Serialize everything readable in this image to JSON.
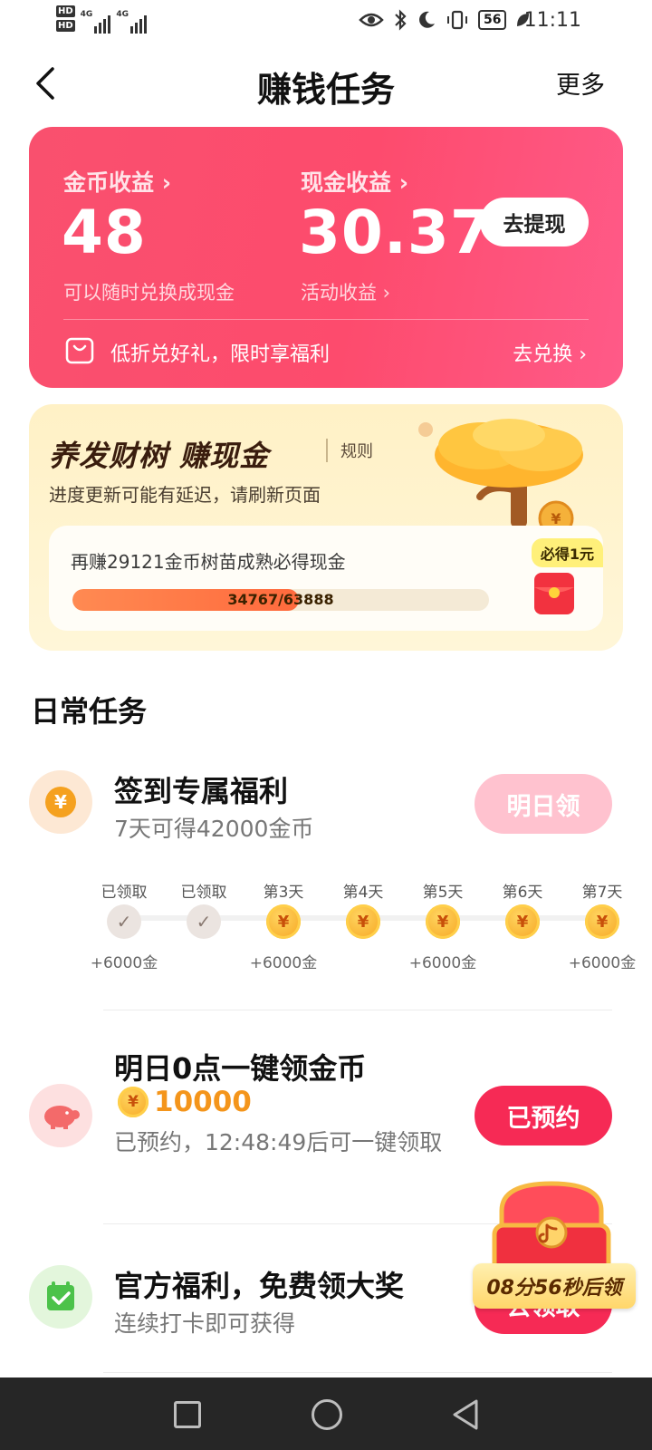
{
  "status_bar": {
    "hd1": "HD",
    "hd2": "HD",
    "signal1": "4G",
    "signal2": "4G",
    "battery": "56",
    "time": "11:11"
  },
  "header": {
    "title": "赚钱任务",
    "more": "更多"
  },
  "earnings": {
    "coin_label": "金币收益 ›",
    "coin_value": "48",
    "coin_sub": "可以随时兑换成现金",
    "cash_label": "现金收益 ›",
    "cash_value": "30.37",
    "cash_sub": "活动收益 ›",
    "withdraw": "去提现",
    "promo": "低折兑好礼，限时享福利",
    "exchange": "去兑换 ›"
  },
  "tree": {
    "title_part1": "养发财树",
    "title_part2": "赚现金",
    "rules": "规则",
    "subtitle": "进度更新可能有延迟，请刷新页面",
    "progress_text": "再赚29121金币树苗成熟必得现金",
    "progress_label": "34767/63888",
    "progress_fraction": 0.544,
    "badge": "必得1元"
  },
  "daily": {
    "section_title": "日常任务",
    "checkin": {
      "title": "签到专属福利",
      "desc": "7天可得42000金币",
      "button": "明日领",
      "days": [
        {
          "label": "已领取",
          "state": "done",
          "reward": "+6000金"
        },
        {
          "label": "已领取",
          "state": "done",
          "reward": ""
        },
        {
          "label": "第3天",
          "state": "coin",
          "reward": "+6000金"
        },
        {
          "label": "第4天",
          "state": "coin",
          "reward": ""
        },
        {
          "label": "第5天",
          "state": "coin",
          "reward": "+6000金"
        },
        {
          "label": "第6天",
          "state": "coin",
          "reward": ""
        },
        {
          "label": "第7天",
          "state": "coin",
          "reward": "+6000金"
        }
      ]
    },
    "gold": {
      "title": "明日0点一键领金币",
      "amount": "10000",
      "desc": "已预约，12:48:49后可一键领取",
      "button": "已预约"
    },
    "official": {
      "title": "官方福利，免费领大奖",
      "desc": "连续打卡即可获得",
      "button": "去领取"
    }
  },
  "chest": {
    "countdown": "08分56秒后领"
  },
  "colors": {
    "card_red": "#fd4b6d",
    "button_red": "#f62a55",
    "coin_orange": "#f4951b",
    "tree_bg": "#fff1c6"
  }
}
